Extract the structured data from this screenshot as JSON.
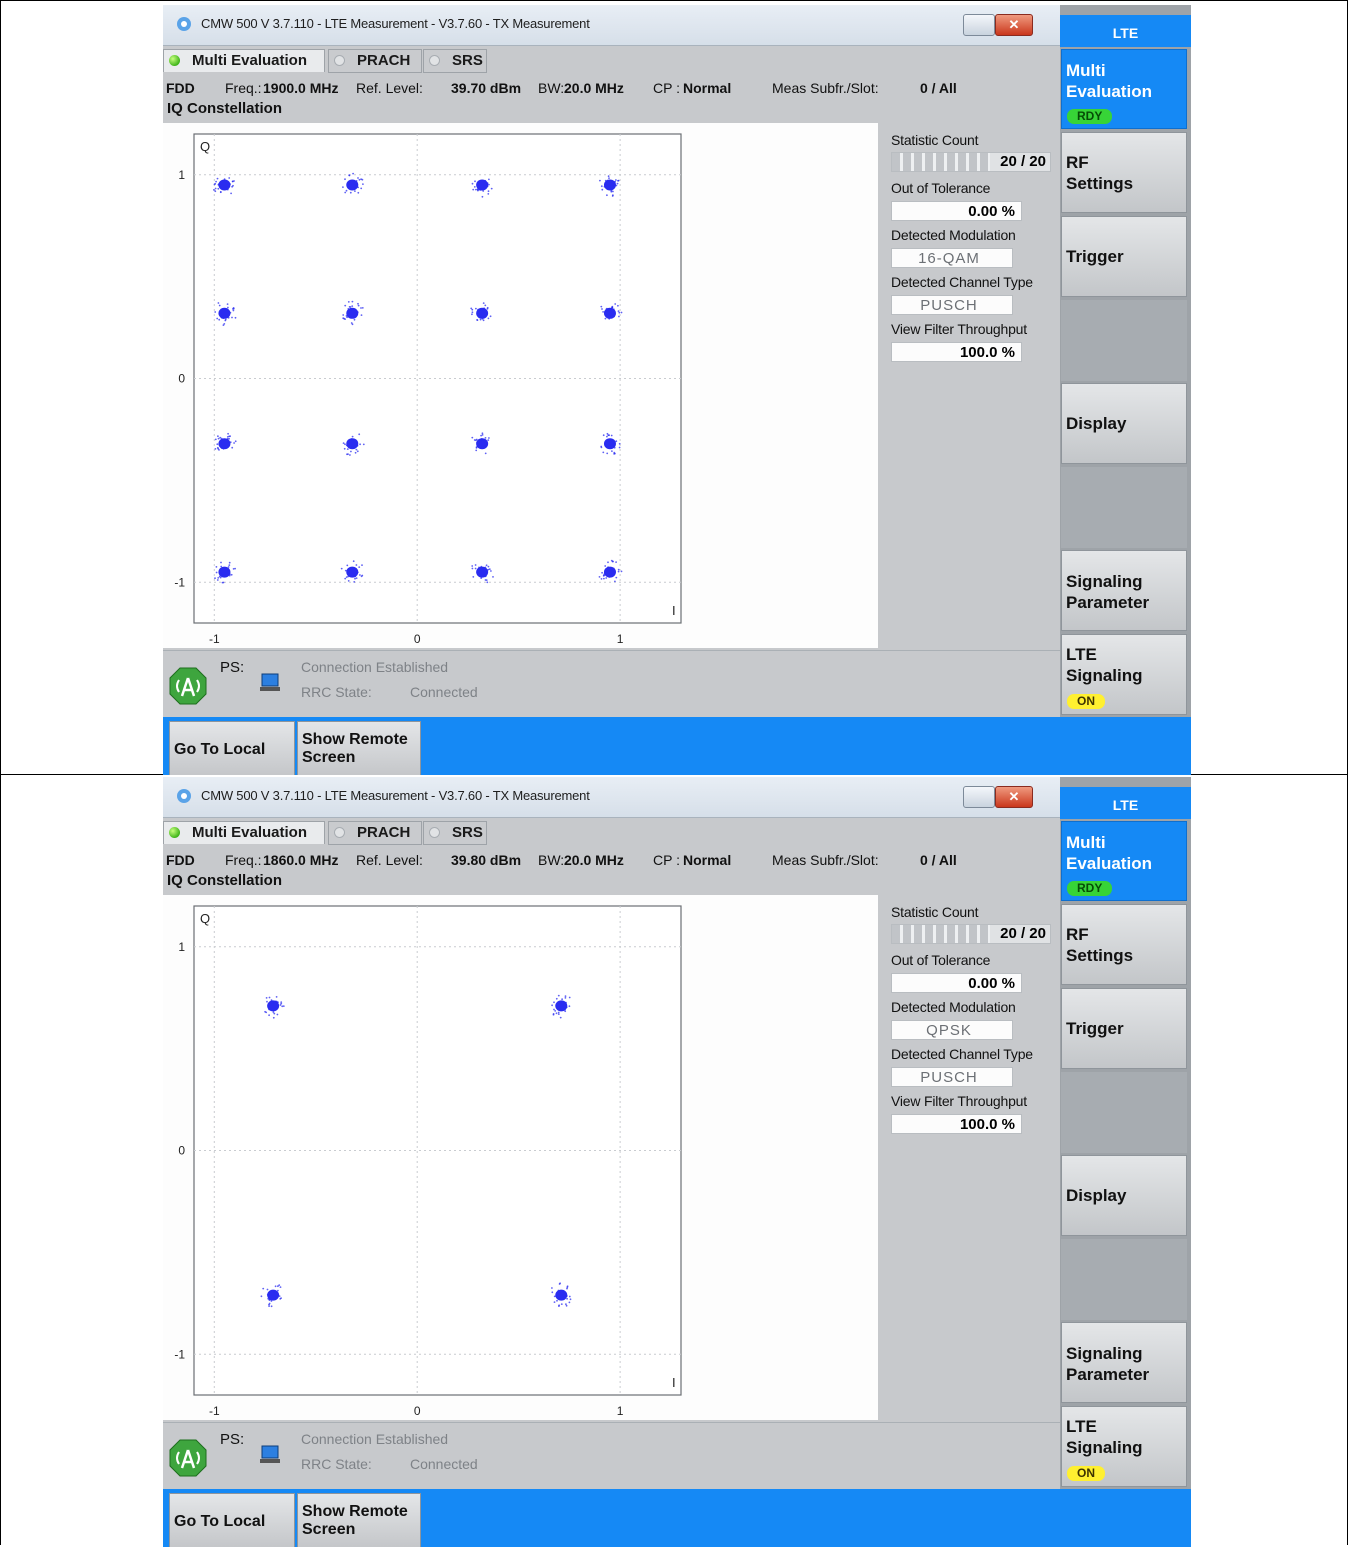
{
  "screens": [
    {
      "window_title": "CMW 500 V 3.7.110 - LTE Measurement  - V3.7.60 - TX Measurement",
      "tabs": [
        "Multi Evaluation",
        "PRACH",
        "SRS"
      ],
      "params": {
        "duplex": "FDD",
        "freq_label": "Freq.:",
        "freq_value": "1900.0 MHz",
        "ref_label": "Ref. Level:",
        "ref_value": "39.70 dBm",
        "bw_label": "BW:",
        "bw_value": "20.0 MHz",
        "cp_label": "CP :",
        "cp_value": "Normal",
        "subfr_label": "Meas Subfr./Slot:",
        "subfr_value": "0  / All"
      },
      "section_title": "IQ Constellation",
      "chart_data": {
        "type": "scatter",
        "title": "IQ Constellation",
        "xlabel": "I",
        "ylabel": "Q",
        "xlim": [
          -1.1,
          1.3
        ],
        "ylim": [
          -1.2,
          1.2
        ],
        "x_ticks": [
          "-1",
          "0",
          "1"
        ],
        "y_ticks": [
          "1",
          "0",
          "-1"
        ],
        "grid": true,
        "series": [
          {
            "points": [
              [
                -0.95,
                0.95
              ],
              [
                -0.32,
                0.95
              ],
              [
                0.32,
                0.95
              ],
              [
                0.95,
                0.95
              ],
              [
                -0.95,
                0.32
              ],
              [
                -0.32,
                0.32
              ],
              [
                0.32,
                0.32
              ],
              [
                0.95,
                0.32
              ],
              [
                -0.95,
                -0.32
              ],
              [
                -0.32,
                -0.32
              ],
              [
                0.32,
                -0.32
              ],
              [
                0.95,
                -0.32
              ],
              [
                -0.95,
                -0.95
              ],
              [
                -0.32,
                -0.95
              ],
              [
                0.32,
                -0.95
              ],
              [
                0.95,
                -0.95
              ]
            ],
            "color": "#2a2cf0"
          }
        ]
      },
      "statistic_count_label": "Statistic Count",
      "statistic_count_value": "20 / 20",
      "statistic_progress": 1.0,
      "out_of_tolerance_label": "Out of Tolerance",
      "out_of_tolerance_value": "0.00  %",
      "detected_modulation_label": "Detected Modulation",
      "detected_modulation_value": "16-QAM",
      "detected_channel_label": "Detected Channel Type",
      "detected_channel_value": "PUSCH",
      "view_filter_label": "View Filter Throughput",
      "view_filter_value": "100.0  %",
      "status": {
        "ps_label": "PS:",
        "connection": "Connection Established",
        "rrc_label": "RRC State:",
        "rrc_value": "Connected"
      },
      "bottom_buttons": [
        "Go To Local",
        "Show Remote Screen"
      ],
      "softkeys": {
        "header": "LTE",
        "multi_eval_line1": "Multi",
        "multi_eval_line2": "Evaluation",
        "multi_eval_badge": "RDY",
        "rf_line1": "RF",
        "rf_line2": "Settings",
        "trigger": "Trigger",
        "display": "Display",
        "sig_line1": "Signaling",
        "sig_line2": "Parameter",
        "lte_line1": "LTE",
        "lte_line2": "Signaling",
        "lte_badge": "ON"
      }
    },
    {
      "window_title": "CMW 500 V 3.7.110 - LTE Measurement  - V3.7.60 - TX Measurement",
      "tabs": [
        "Multi Evaluation",
        "PRACH",
        "SRS"
      ],
      "params": {
        "duplex": "FDD",
        "freq_label": "Freq.:",
        "freq_value": "1860.0 MHz",
        "ref_label": "Ref. Level:",
        "ref_value": "39.80 dBm",
        "bw_label": "BW:",
        "bw_value": "20.0 MHz",
        "cp_label": "CP :",
        "cp_value": "Normal",
        "subfr_label": "Meas Subfr./Slot:",
        "subfr_value": "0  / All"
      },
      "section_title": "IQ Constellation",
      "chart_data": {
        "type": "scatter",
        "title": "IQ Constellation",
        "xlabel": "I",
        "ylabel": "Q",
        "xlim": [
          -1.1,
          1.3
        ],
        "ylim": [
          -1.2,
          1.2
        ],
        "x_ticks": [
          "-1",
          "0",
          "1"
        ],
        "y_ticks": [
          "1",
          "0",
          "-1"
        ],
        "grid": true,
        "series": [
          {
            "points": [
              [
                -0.71,
                0.71
              ],
              [
                0.71,
                0.71
              ],
              [
                -0.71,
                -0.71
              ],
              [
                0.71,
                -0.71
              ]
            ],
            "color": "#2a2cf0"
          }
        ]
      },
      "statistic_count_label": "Statistic Count",
      "statistic_count_value": "20 / 20",
      "statistic_progress": 1.0,
      "out_of_tolerance_label": "Out of Tolerance",
      "out_of_tolerance_value": "0.00  %",
      "detected_modulation_label": "Detected Modulation",
      "detected_modulation_value": "QPSK",
      "detected_channel_label": "Detected Channel Type",
      "detected_channel_value": "PUSCH",
      "view_filter_label": "View Filter Throughput",
      "view_filter_value": "100.0  %",
      "status": {
        "ps_label": "PS:",
        "connection": "Connection Established",
        "rrc_label": "RRC State:",
        "rrc_value": "Connected"
      },
      "bottom_buttons": [
        "Go To Local",
        "Show Remote Screen"
      ],
      "softkeys": {
        "header": "LTE",
        "multi_eval_line1": "Multi",
        "multi_eval_line2": "Evaluation",
        "multi_eval_badge": "RDY",
        "rf_line1": "RF",
        "rf_line2": "Settings",
        "trigger": "Trigger",
        "display": "Display",
        "sig_line1": "Signaling",
        "sig_line2": "Parameter",
        "lte_line1": "LTE",
        "lte_line2": "Signaling",
        "lte_badge": "ON"
      }
    }
  ]
}
